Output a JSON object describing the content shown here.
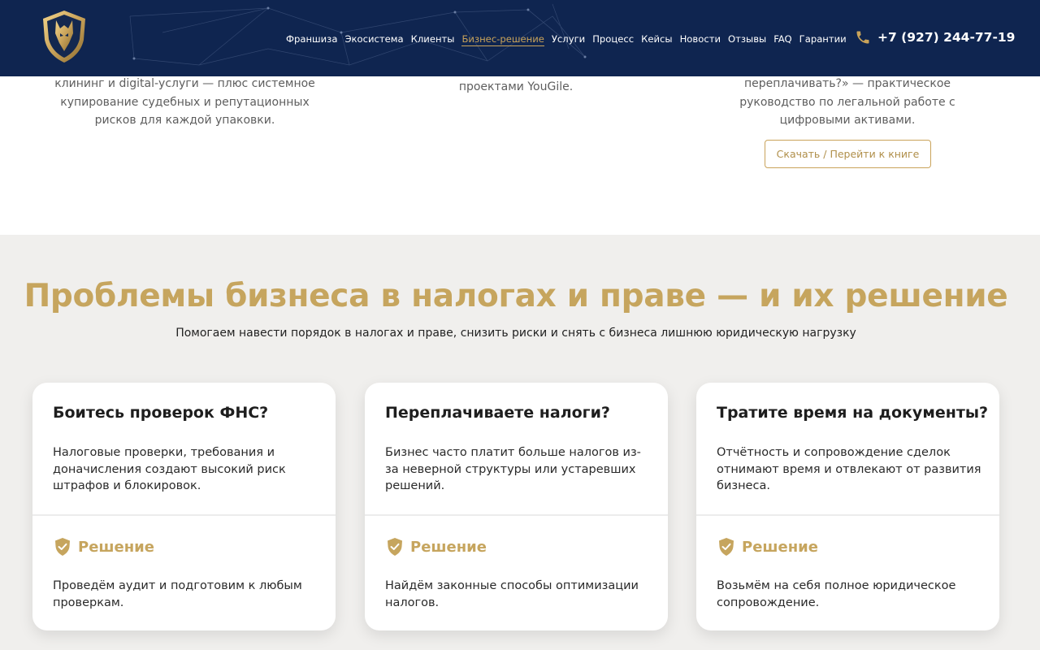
{
  "header": {
    "nav": [
      "Франшиза",
      "Экосистема",
      "Клиенты",
      "Бизнес-решение",
      "Услуги",
      "Процесс",
      "Кейсы",
      "Новости",
      "Отзывы",
      "FAQ",
      "Гарантии"
    ],
    "active_nav": "Бизнес-решение",
    "phone": "+7 (927) 244-77-19",
    "phone_icon": "phone-icon",
    "logo_icon": "wolf-shield-logo"
  },
  "prev_cards": {
    "col1": "клининг и digital-услуги — плюс системное купирование судебных и репутационных рисков для каждой упаковки.",
    "col2": "проектами YouGile.",
    "col3": "переплачивать?» — практическое руководство по легальной работе с цифровыми активами.",
    "download_button": "Скачать / Перейти к книге"
  },
  "section": {
    "title": "Проблемы бизнеса в налогах и праве — и их решение",
    "subtitle": "Помогаем навести порядок в налогах и праве, снизить риски и снять с бизнеса лишнюю юридическую нагрузку",
    "solution_label": "Решение",
    "cards": [
      {
        "title": "Боитесь проверок ФНС?",
        "text": "Налоговые проверки, требования и доначисления создают высокий риск штрафов и блокировок.",
        "solution": "Проведём аудит и подготовим к любым проверкам."
      },
      {
        "title": "Переплачиваете налоги?",
        "text": "Бизнес часто платит больше налогов из-за неверной структуры или устаревших решений.",
        "solution": "Найдём законные способы оптимизации налогов."
      },
      {
        "title": "Тратите время на документы?",
        "text": "Отчётность и сопровождение сделок отнимают время и отвлекают от развития бизнеса.",
        "solution": "Возьмём на себя полное юридическое сопровождение."
      }
    ]
  },
  "colors": {
    "header_bg": "#0f2550",
    "gold": "#c6a55e",
    "section_bg": "#f0efed"
  }
}
